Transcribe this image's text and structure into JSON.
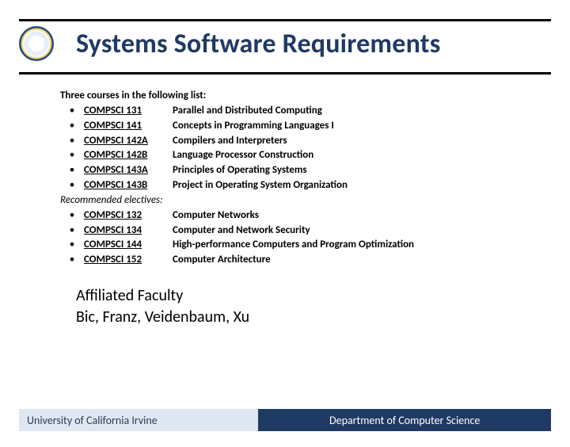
{
  "title": "Systems Software Requirements",
  "intro": "Three courses in the following list:",
  "required": [
    {
      "code": "COMPSCI 131",
      "name": "Parallel and Distributed Computing"
    },
    {
      "code": "COMPSCI 141",
      "name": "Concepts in Programming Languages I"
    },
    {
      "code": "COMPSCI 142A",
      "name": "Compilers and Interpreters"
    },
    {
      "code": "COMPSCI 142B",
      "name": "Language Processor Construction"
    },
    {
      "code": "COMPSCI 143A",
      "name": "Principles of Operating Systems"
    },
    {
      "code": "COMPSCI 143B",
      "name": "Project in Operating System Organization"
    }
  ],
  "recommended_label": "Recommended electives:",
  "electives": [
    {
      "code": "COMPSCI 132",
      "name": "Computer Networks"
    },
    {
      "code": "COMPSCI 134",
      "name": "Computer and Network Security"
    },
    {
      "code": "COMPSCI 144",
      "name": "High-performance Computers and Program Optimization"
    },
    {
      "code": "COMPSCI 152",
      "name": "Computer Architecture"
    }
  ],
  "faculty_heading": "Affiliated Faculty",
  "faculty_list": "Bic, Franz, Veidenbaum, Xu",
  "footer": {
    "left": "University of California Irvine",
    "right": "Department of Computer Science"
  }
}
